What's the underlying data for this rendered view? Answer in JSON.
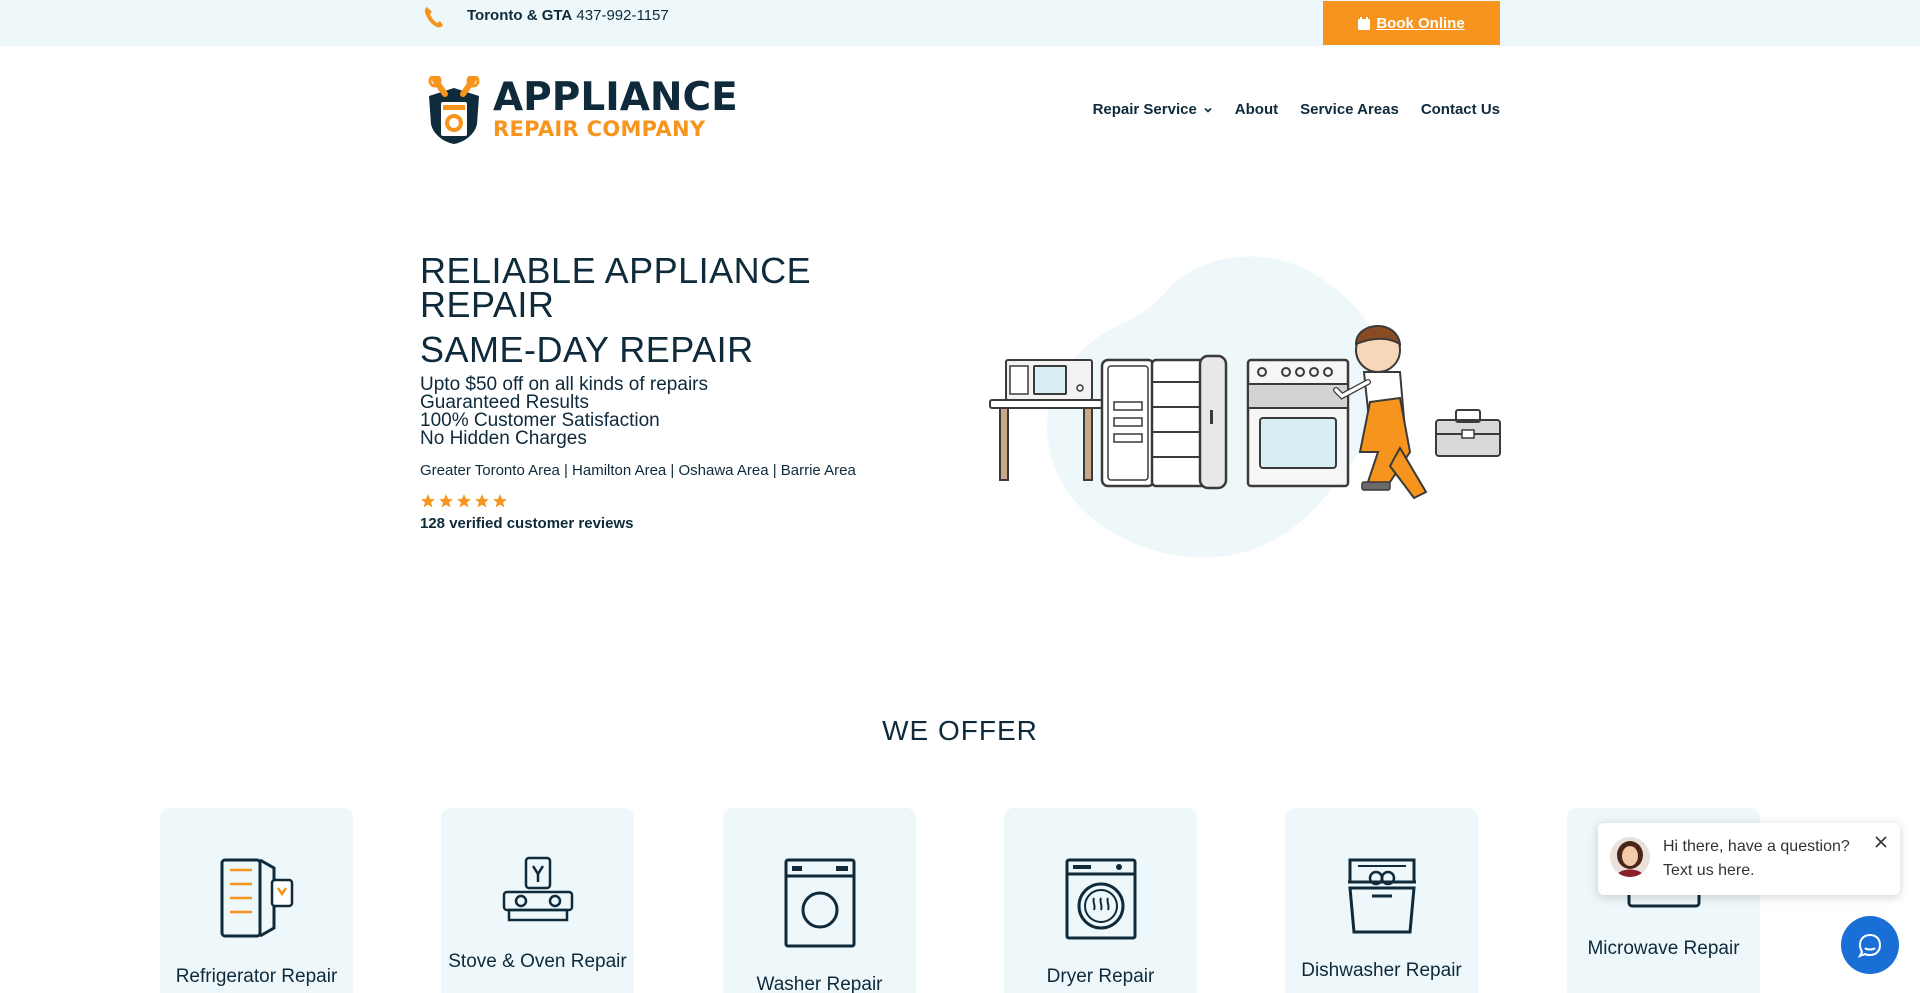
{
  "topbar": {
    "region": "Toronto & GTA",
    "phone": "437-992-1157",
    "book_label": "Book Online"
  },
  "logo": {
    "line1": "APPLIANCE",
    "line2": "REPAIR COMPANY"
  },
  "nav": {
    "items": [
      {
        "label": "Repair Service"
      },
      {
        "label": "About"
      },
      {
        "label": "Service Areas"
      },
      {
        "label": "Contact Us"
      }
    ]
  },
  "hero": {
    "title": "RELIABLE APPLIANCE REPAIR",
    "subtitle": "SAME-DAY REPAIR",
    "lines": [
      "Upto $50 off on all kinds of repairs",
      "Guaranteed Results",
      "100% Customer Satisfaction",
      "No Hidden Charges"
    ],
    "areas": "Greater Toronto Area | Hamilton Area | Oshawa Area | Barrie Area",
    "rating": 5,
    "reviews": "128 verified customer reviews"
  },
  "offer": {
    "heading": "WE OFFER",
    "cards": [
      {
        "label": "Refrigerator Repair",
        "icon": "refrigerator-icon"
      },
      {
        "label": "Stove & Oven Repair",
        "icon": "stove-icon"
      },
      {
        "label": "Washer Repair",
        "icon": "washer-icon"
      },
      {
        "label": "Dryer Repair",
        "icon": "dryer-icon"
      },
      {
        "label": "Dishwasher Repair",
        "icon": "dishwasher-icon"
      },
      {
        "label": "Microwave Repair",
        "icon": "microwave-icon"
      }
    ]
  },
  "chat": {
    "line1": "Hi there, have a question?",
    "line2": "Text us here."
  },
  "colors": {
    "accent": "#f7941d",
    "navy": "#0e2a3b",
    "light": "#eef7f9",
    "chat": "#1a6fd6"
  }
}
